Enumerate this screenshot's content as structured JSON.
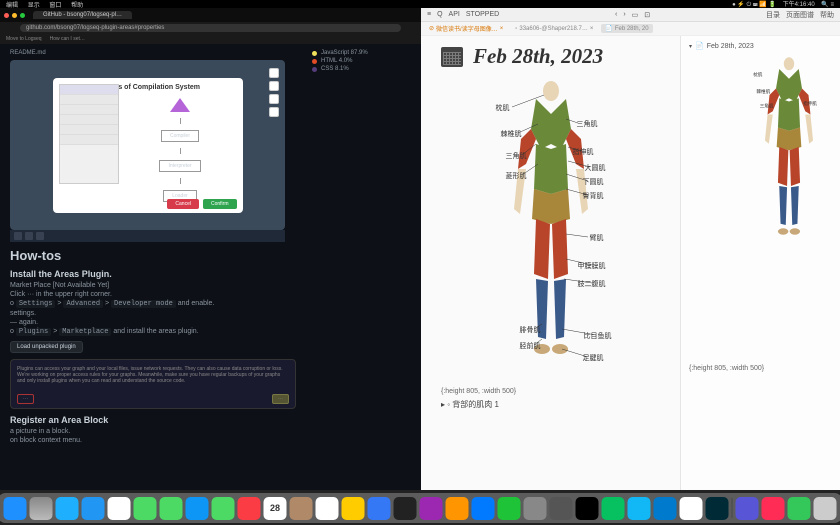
{
  "menubar": {
    "left": [
      "编辑",
      "显示",
      "窗口",
      "帮助"
    ],
    "right_time": "下午4:16:40"
  },
  "browser": {
    "tab_title": "GitHub - bsong07/logseq-pl…",
    "url": "github.com/bsong07/logseq-plugin-areas#properties",
    "bookmarks": [
      "Move to Logseq",
      "How can I set…"
    ],
    "readme": {
      "file_label": "README.md",
      "modal_title": "Process of Compilation System",
      "flow_boxes": [
        "Compiler",
        "Interpreter",
        "Loader"
      ],
      "cancel": "Cancel",
      "confirm": "Confirm"
    },
    "sections": {
      "howtos": "How-tos",
      "install_h": "Install the Areas Plugin.",
      "install_note": "Market Place [Not Available Yet]",
      "steps": [
        "Click ··· in the upper right corner.",
        "Settings > Advanced > Developer mode and enable.",
        "settings.",
        "— again.",
        "Plugins > Marketplace and install the areas plugin."
      ],
      "load_btn": "Load unpacked plugin",
      "warn_text": "Plugins can access your graph and your local files, issue network requests. They can also cause data corruption or loss. We're working on proper access rules for your graphs. Meanwhile, make sure you have regular backups of your graphs and only install plugins when you can read and understand the source code.",
      "register_h": "Register an Area Block",
      "register_steps": [
        "a picture in a block.",
        "on block context menu."
      ]
    },
    "langs": {
      "js": "JavaScript 87.9%",
      "html": "HTML 4.0%",
      "css": "CSS 8.1%"
    }
  },
  "notes": {
    "titlebar": {
      "api": "API",
      "status": "STOPPED",
      "navs": [
        "目录",
        "页面图谱",
        "帮助"
      ]
    },
    "tabs": [
      "微信读书/读字母图像…",
      "33a606-@Shaper218.7…",
      "Feb 28th, 20"
    ],
    "date": "Feb 28th, 2023",
    "tree_date": "Feb 28th, 2023",
    "caption": "{:height 805, :width 500}",
    "bullet1": "背部的肌肉 1",
    "muscle_labels": {
      "l1": "枕肌",
      "l2": "棘椎肌",
      "l3": "三角肌",
      "l4": "菱形肌",
      "l5": "腓骨肌",
      "l6": "胫前肌",
      "r1": "三角肌",
      "r2": "指伸肌",
      "r3": "大圆肌",
      "r4": "下圆肌",
      "r5": "臀背肌",
      "r6": "臂肌",
      "r7": "甲膜膜肌",
      "r8": "肢二腹肌",
      "r9": "比目鱼肌",
      "r10": "足腱肌"
    }
  },
  "dock": {
    "icons": [
      {
        "name": "finder",
        "bg": "#1e90ff"
      },
      {
        "name": "launchpad",
        "bg": "linear-gradient(#888,#bbb)"
      },
      {
        "name": "safari",
        "bg": "#1eb0ff"
      },
      {
        "name": "mail",
        "bg": "#2196f3"
      },
      {
        "name": "photos",
        "bg": "#fff"
      },
      {
        "name": "messages",
        "bg": "#4cd964"
      },
      {
        "name": "maps",
        "bg": "#4cd964"
      },
      {
        "name": "store",
        "bg": "#0d96f6"
      },
      {
        "name": "facetime",
        "bg": "#4cd964"
      },
      {
        "name": "music",
        "bg": "#fc3c44"
      },
      {
        "name": "calendar",
        "bg": "#fff",
        "text": "28",
        "color": "#333"
      },
      {
        "name": "contacts",
        "bg": "#b08968"
      },
      {
        "name": "reminders",
        "bg": "#fff"
      },
      {
        "name": "notes",
        "bg": "#ffcc00"
      },
      {
        "name": "preview",
        "bg": "#3478f6"
      },
      {
        "name": "tv",
        "bg": "#222"
      },
      {
        "name": "podcasts",
        "bg": "#9c27b0"
      },
      {
        "name": "books",
        "bg": "#ff9500"
      },
      {
        "name": "keynote",
        "bg": "#027aff"
      },
      {
        "name": "numbers",
        "bg": "#1ec337"
      },
      {
        "name": "settings",
        "bg": "#888"
      },
      {
        "name": "utility",
        "bg": "#555"
      },
      {
        "name": "terminal",
        "bg": "#000"
      },
      {
        "name": "wechat",
        "bg": "#07c160"
      },
      {
        "name": "qq",
        "bg": "#12b7f5"
      },
      {
        "name": "vscode",
        "bg": "#007acc"
      },
      {
        "name": "chrome",
        "bg": "#fff"
      },
      {
        "name": "logseq",
        "bg": "#002b36"
      },
      {
        "name": "app1",
        "bg": "#5856d6"
      },
      {
        "name": "app2",
        "bg": "#ff2d55"
      },
      {
        "name": "app3",
        "bg": "#34c759"
      },
      {
        "name": "trash",
        "bg": "#ccc"
      }
    ]
  }
}
